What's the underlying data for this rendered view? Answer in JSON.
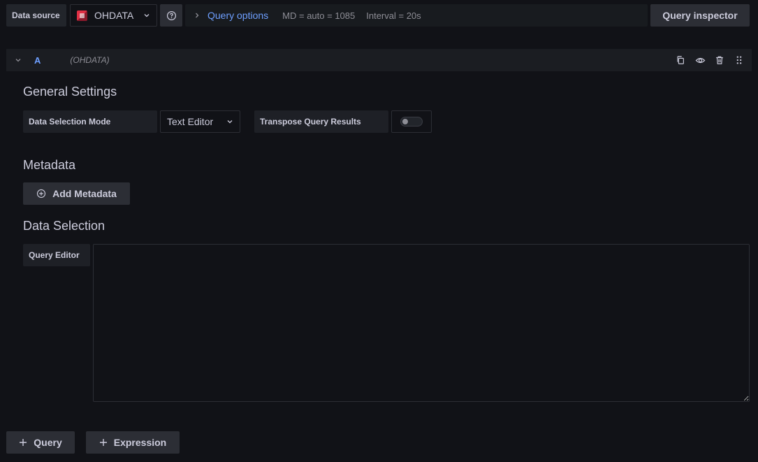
{
  "toolbar": {
    "data_source_label": "Data source",
    "data_source_value": "OHDATA",
    "query_options_label": "Query options",
    "md_info": "MD = auto = 1085",
    "interval_info": "Interval = 20s",
    "query_inspector_label": "Query inspector"
  },
  "query": {
    "ref_id": "A",
    "datasource_name": "(OHDATA)"
  },
  "general_settings": {
    "title": "General Settings",
    "data_selection_mode_label": "Data Selection Mode",
    "data_selection_mode_value": "Text Editor",
    "transpose_label": "Transpose Query Results",
    "transpose_enabled": false
  },
  "metadata": {
    "title": "Metadata",
    "add_button": "Add Metadata"
  },
  "data_selection": {
    "title": "Data Selection",
    "query_editor_label": "Query Editor",
    "query_editor_value": ""
  },
  "footer": {
    "add_query_button": "Query",
    "add_expression_button": "Expression"
  },
  "colors": {
    "background": "#111217",
    "accent": "#6e9fff",
    "panel": "#1b1d22",
    "button": "#2c2e35",
    "datasource_logo": "#e02f44"
  },
  "icons": {
    "help": "question-circle-icon",
    "collapse": "chevron-down-icon",
    "duplicate": "copy-icon",
    "preview": "eye-icon",
    "delete": "trash-icon",
    "drag": "drag-handle-icon",
    "add": "plus-icon",
    "add_circle": "plus-circle-icon"
  }
}
